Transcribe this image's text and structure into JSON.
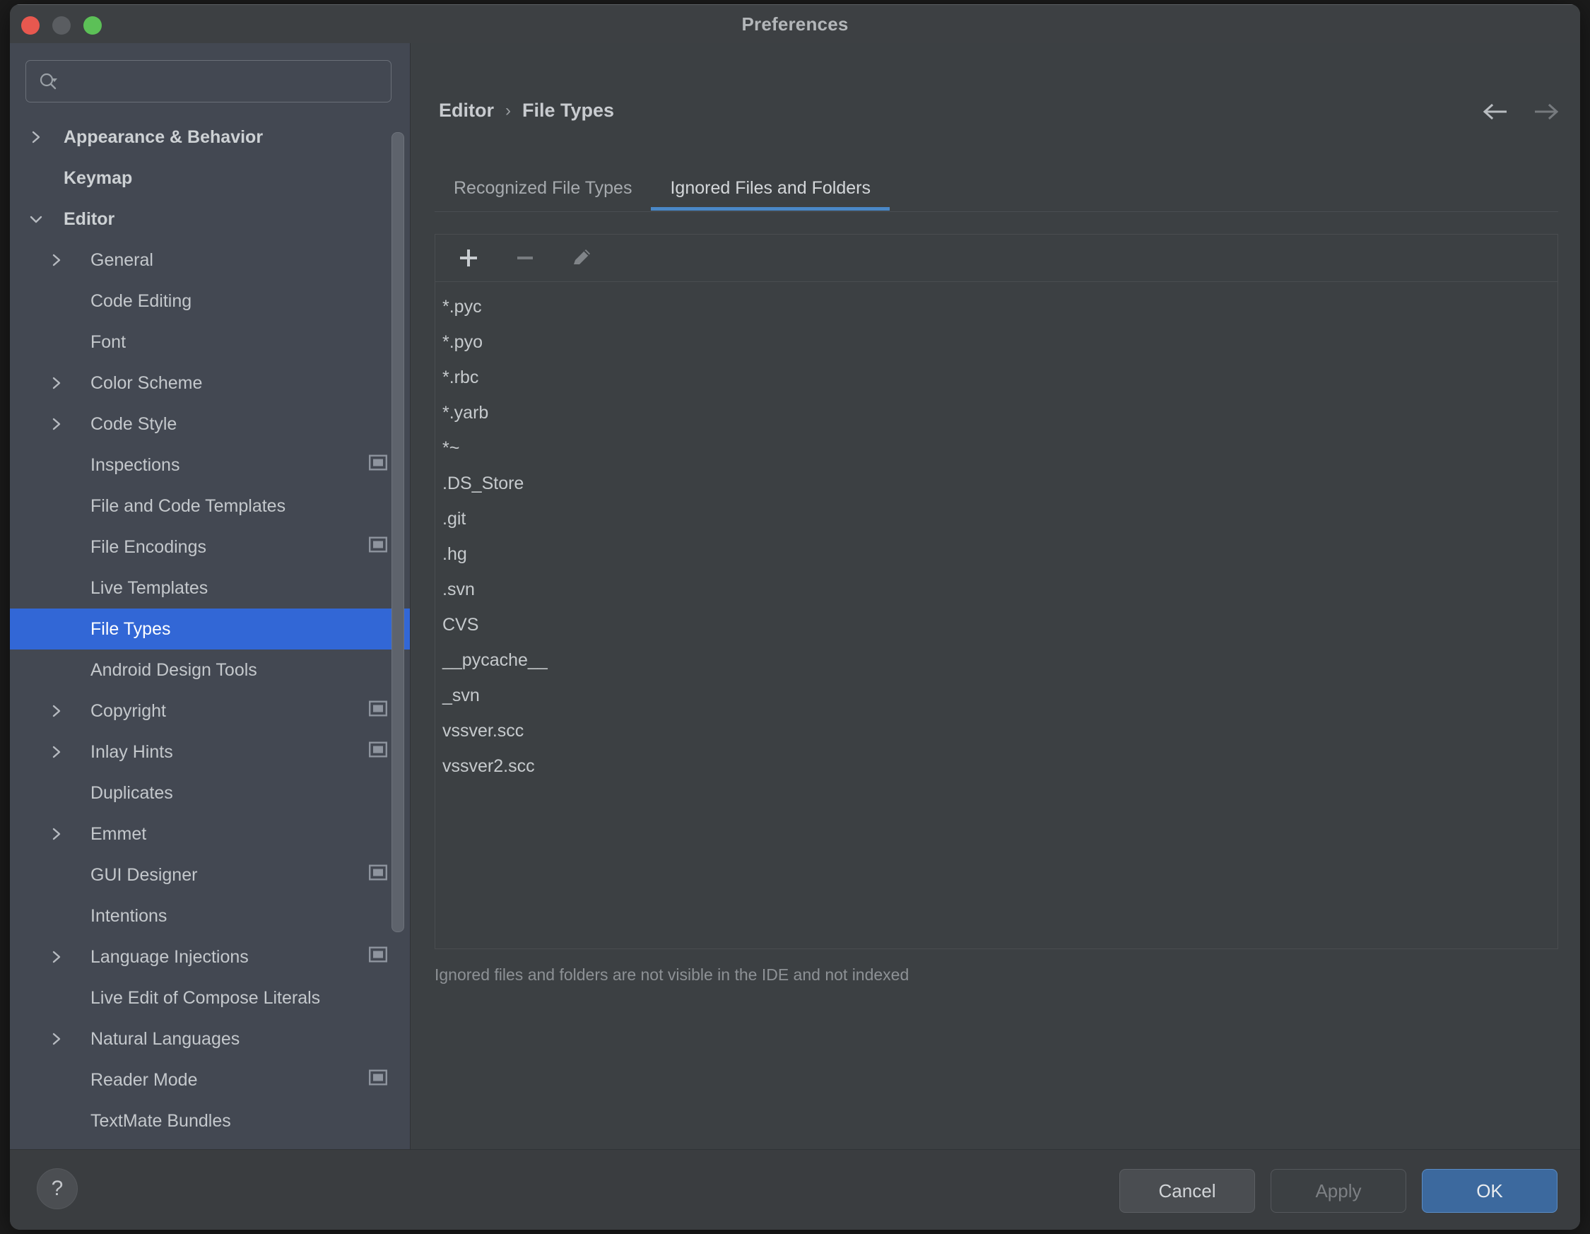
{
  "window": {
    "title": "Preferences",
    "traffic_lights": [
      "close",
      "minimize",
      "zoom"
    ]
  },
  "sidebar": {
    "search": {
      "value": "",
      "placeholder": ""
    },
    "items": [
      {
        "label": "Appearance & Behavior",
        "depth": 0,
        "chevron": "right",
        "bold": true,
        "icon": null,
        "selected": false
      },
      {
        "label": "Keymap",
        "depth": 0,
        "chevron": null,
        "bold": true,
        "icon": null,
        "selected": false
      },
      {
        "label": "Editor",
        "depth": 0,
        "chevron": "down",
        "bold": true,
        "icon": null,
        "selected": false
      },
      {
        "label": "General",
        "depth": 1,
        "chevron": "right",
        "bold": false,
        "icon": null,
        "selected": false
      },
      {
        "label": "Code Editing",
        "depth": 1,
        "chevron": null,
        "bold": false,
        "icon": null,
        "selected": false
      },
      {
        "label": "Font",
        "depth": 1,
        "chevron": null,
        "bold": false,
        "icon": null,
        "selected": false
      },
      {
        "label": "Color Scheme",
        "depth": 1,
        "chevron": "right",
        "bold": false,
        "icon": null,
        "selected": false
      },
      {
        "label": "Code Style",
        "depth": 1,
        "chevron": "right",
        "bold": false,
        "icon": null,
        "selected": false
      },
      {
        "label": "Inspections",
        "depth": 1,
        "chevron": null,
        "bold": false,
        "icon": "project-scope-icon",
        "selected": false
      },
      {
        "label": "File and Code Templates",
        "depth": 1,
        "chevron": null,
        "bold": false,
        "icon": null,
        "selected": false
      },
      {
        "label": "File Encodings",
        "depth": 1,
        "chevron": null,
        "bold": false,
        "icon": "project-scope-icon",
        "selected": false
      },
      {
        "label": "Live Templates",
        "depth": 1,
        "chevron": null,
        "bold": false,
        "icon": null,
        "selected": false
      },
      {
        "label": "File Types",
        "depth": 1,
        "chevron": null,
        "bold": false,
        "icon": null,
        "selected": true
      },
      {
        "label": "Android Design Tools",
        "depth": 1,
        "chevron": null,
        "bold": false,
        "icon": null,
        "selected": false
      },
      {
        "label": "Copyright",
        "depth": 1,
        "chevron": "right",
        "bold": false,
        "icon": "project-scope-icon",
        "selected": false
      },
      {
        "label": "Inlay Hints",
        "depth": 1,
        "chevron": "right",
        "bold": false,
        "icon": "project-scope-icon",
        "selected": false
      },
      {
        "label": "Duplicates",
        "depth": 1,
        "chevron": null,
        "bold": false,
        "icon": null,
        "selected": false
      },
      {
        "label": "Emmet",
        "depth": 1,
        "chevron": "right",
        "bold": false,
        "icon": null,
        "selected": false
      },
      {
        "label": "GUI Designer",
        "depth": 1,
        "chevron": null,
        "bold": false,
        "icon": "project-scope-icon",
        "selected": false
      },
      {
        "label": "Intentions",
        "depth": 1,
        "chevron": null,
        "bold": false,
        "icon": null,
        "selected": false
      },
      {
        "label": "Language Injections",
        "depth": 1,
        "chevron": "right",
        "bold": false,
        "icon": "project-scope-icon",
        "selected": false
      },
      {
        "label": "Live Edit of Compose Literals",
        "depth": 1,
        "chevron": null,
        "bold": false,
        "icon": null,
        "selected": false
      },
      {
        "label": "Natural Languages",
        "depth": 1,
        "chevron": "right",
        "bold": false,
        "icon": null,
        "selected": false
      },
      {
        "label": "Reader Mode",
        "depth": 1,
        "chevron": null,
        "bold": false,
        "icon": "project-scope-icon",
        "selected": false
      },
      {
        "label": "TextMate Bundles",
        "depth": 1,
        "chevron": null,
        "bold": false,
        "icon": null,
        "selected": false
      }
    ]
  },
  "content": {
    "breadcrumb": {
      "parent": "Editor",
      "separator": "›",
      "current": "File Types"
    },
    "nav": {
      "back": "back-arrow",
      "forward": "forward-arrow"
    },
    "tabs": [
      {
        "label": "Recognized File Types",
        "active": false
      },
      {
        "label": "Ignored Files and Folders",
        "active": true
      }
    ],
    "toolbar": [
      {
        "name": "add-button",
        "glyph": "+",
        "enabled": true
      },
      {
        "name": "remove-button",
        "glyph": "−",
        "enabled": false
      },
      {
        "name": "edit-button",
        "glyph": "pencil",
        "enabled": false
      }
    ],
    "ignored_items": [
      "*.pyc",
      "*.pyo",
      "*.rbc",
      "*.yarb",
      "*~",
      ".DS_Store",
      ".git",
      ".hg",
      ".svn",
      "CVS",
      "__pycache__",
      "_svn",
      "vssver.scc",
      "vssver2.scc"
    ],
    "hint": "Ignored files and folders are not visible in the IDE and not indexed"
  },
  "footer": {
    "help_label": "?",
    "buttons": [
      {
        "label": "Cancel",
        "style": "secondary"
      },
      {
        "label": "Apply",
        "style": "disabled"
      },
      {
        "label": "OK",
        "style": "primary"
      }
    ]
  },
  "colors": {
    "accent_selection": "#3267d6",
    "tab_underline": "#4a88c7",
    "primary_button": "#3c699e",
    "sidebar_bg": "#434852",
    "panel_bg": "#3c4043"
  }
}
